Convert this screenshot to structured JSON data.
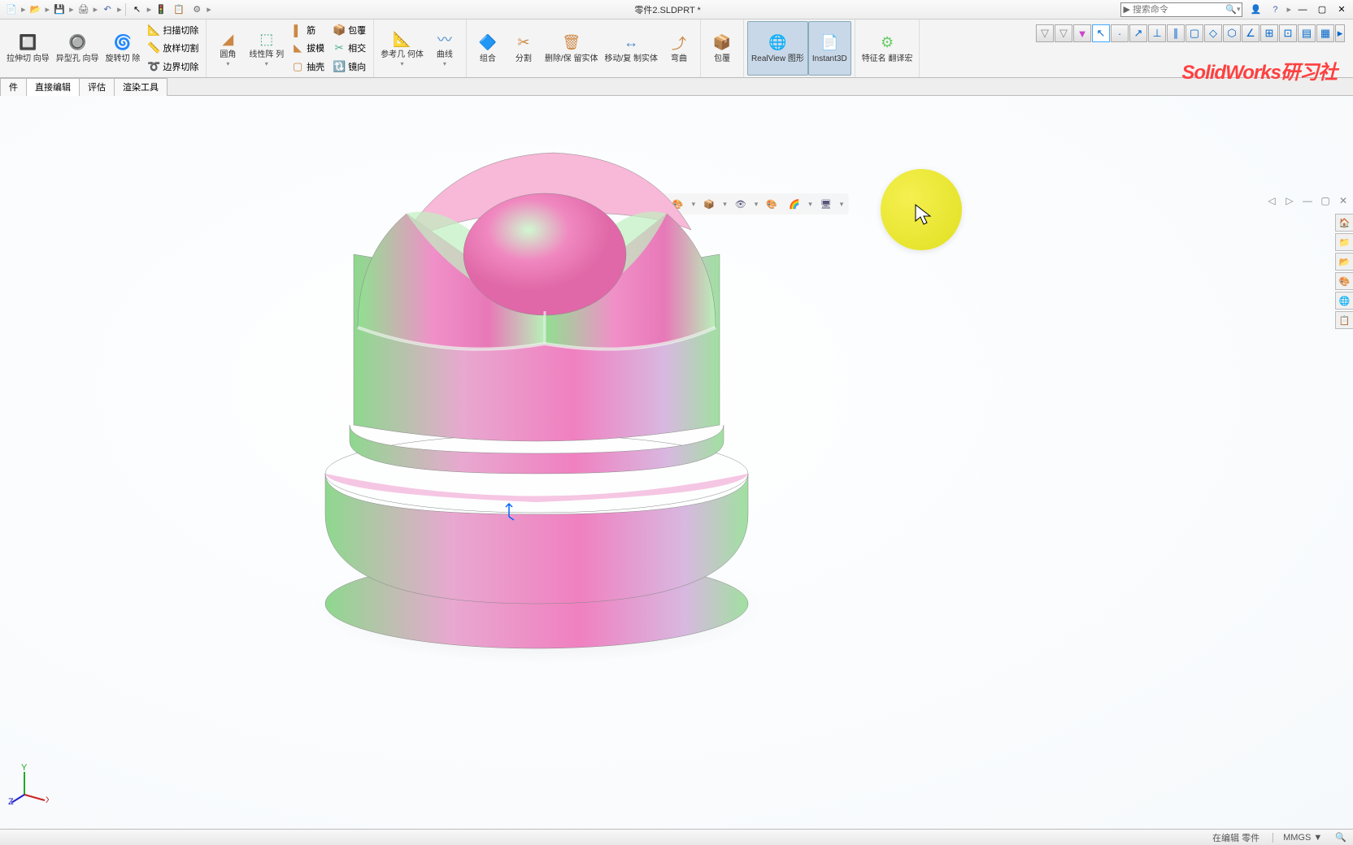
{
  "title": "零件2.SLDPRT *",
  "search_placeholder": "搜索命令",
  "watermark": "SolidWorks研习社",
  "qat": [
    "new",
    "open",
    "save",
    "print",
    "undo",
    "select",
    "rebuild",
    "macro",
    "options",
    "gear"
  ],
  "ribbon": {
    "groups": [
      {
        "big": [
          {
            "ico": "🔲",
            "lbl": "拉伸切\n向导"
          },
          {
            "ico": "🔘",
            "lbl": "异型孔\n向导"
          },
          {
            "ico": "🌀",
            "lbl": "旋转切\n除"
          }
        ],
        "small": [
          {
            "ico": "📐",
            "lbl": "扫描切除"
          },
          {
            "ico": "📏",
            "lbl": "放样切割"
          },
          {
            "ico": "➰",
            "lbl": "边界切除"
          }
        ]
      },
      {
        "small2": [
          [
            {
              "ico": "◢",
              "lbl": "圆角"
            }
          ],
          [
            {
              "ico": "⬚",
              "lbl": "线性阵\n列"
            }
          ],
          [
            {
              "ico": "▌",
              "lbl": "筋"
            },
            {
              "ico": "◣",
              "lbl": "拔模"
            },
            {
              "ico": "▢",
              "lbl": "抽壳"
            }
          ],
          [
            {
              "ico": "📦",
              "lbl": "包覆"
            },
            {
              "ico": "✂",
              "lbl": "相交"
            },
            {
              "ico": "🔃",
              "lbl": "镜向"
            }
          ]
        ]
      },
      {
        "big": [
          {
            "ico": "📐",
            "lbl": "参考几\n何体"
          },
          {
            "ico": "〰",
            "lbl": "曲线"
          }
        ]
      },
      {
        "big": [
          {
            "ico": "🔷",
            "lbl": "组合"
          },
          {
            "ico": "✂",
            "lbl": "分割"
          },
          {
            "ico": "🗑",
            "lbl": "删除/保\n留实体"
          },
          {
            "ico": "↔",
            "lbl": "移动/复\n制实体"
          },
          {
            "ico": "⤴",
            "lbl": "弯曲"
          }
        ]
      },
      {
        "big": [
          {
            "ico": "📦",
            "lbl": "包覆"
          }
        ]
      },
      {
        "big": [
          {
            "ico": "🌐",
            "lbl": "RealView\n图形",
            "active": true
          },
          {
            "ico": "📄",
            "lbl": "Instant3D",
            "active": true
          }
        ]
      },
      {
        "big": [
          {
            "ico": "⚙",
            "lbl": "特征名\n翻译宏"
          }
        ]
      }
    ]
  },
  "tabs": [
    {
      "label": "件",
      "active": false
    },
    {
      "label": "直接编辑",
      "active": true
    },
    {
      "label": "评估",
      "active": false
    },
    {
      "label": "渲染工具",
      "active": false
    }
  ],
  "view_toolbar": [
    "🔍",
    "🔎",
    "🔲",
    "🎯",
    "📐",
    "🔷",
    "📦",
    "🎨",
    "▼",
    "👁",
    "🎨",
    "🌈",
    "▼",
    "🖥"
  ],
  "right_quick": [
    "🔽",
    "🔽",
    "▼",
    "↖",
    "·",
    "↗",
    "⊥",
    "∥",
    "▢",
    "◇",
    "⬡",
    "∠",
    "⊞",
    "⊡",
    "▤",
    "▦",
    "▼"
  ],
  "side_tabs": [
    "🏠",
    "📁",
    "📂",
    "🎨",
    "🌐",
    "📋"
  ],
  "status": {
    "edit": "在编辑 零件",
    "units": "MMGS",
    "arrow": "▼"
  }
}
